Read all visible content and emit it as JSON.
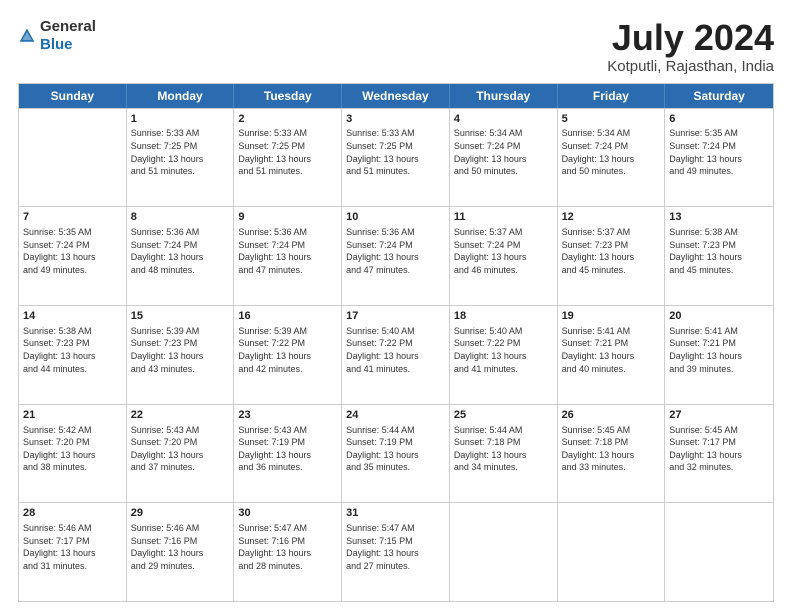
{
  "logo": {
    "text_general": "General",
    "text_blue": "Blue"
  },
  "header": {
    "month_year": "July 2024",
    "location": "Kotputli, Rajasthan, India"
  },
  "weekdays": [
    "Sunday",
    "Monday",
    "Tuesday",
    "Wednesday",
    "Thursday",
    "Friday",
    "Saturday"
  ],
  "weeks": [
    [
      {
        "day": "",
        "sunrise": "",
        "sunset": "",
        "daylight": ""
      },
      {
        "day": "1",
        "sunrise": "Sunrise: 5:33 AM",
        "sunset": "Sunset: 7:25 PM",
        "daylight": "Daylight: 13 hours and 51 minutes."
      },
      {
        "day": "2",
        "sunrise": "Sunrise: 5:33 AM",
        "sunset": "Sunset: 7:25 PM",
        "daylight": "Daylight: 13 hours and 51 minutes."
      },
      {
        "day": "3",
        "sunrise": "Sunrise: 5:33 AM",
        "sunset": "Sunset: 7:25 PM",
        "daylight": "Daylight: 13 hours and 51 minutes."
      },
      {
        "day": "4",
        "sunrise": "Sunrise: 5:34 AM",
        "sunset": "Sunset: 7:24 PM",
        "daylight": "Daylight: 13 hours and 50 minutes."
      },
      {
        "day": "5",
        "sunrise": "Sunrise: 5:34 AM",
        "sunset": "Sunset: 7:24 PM",
        "daylight": "Daylight: 13 hours and 50 minutes."
      },
      {
        "day": "6",
        "sunrise": "Sunrise: 5:35 AM",
        "sunset": "Sunset: 7:24 PM",
        "daylight": "Daylight: 13 hours and 49 minutes."
      }
    ],
    [
      {
        "day": "7",
        "sunrise": "Sunrise: 5:35 AM",
        "sunset": "Sunset: 7:24 PM",
        "daylight": "Daylight: 13 hours and 49 minutes."
      },
      {
        "day": "8",
        "sunrise": "Sunrise: 5:36 AM",
        "sunset": "Sunset: 7:24 PM",
        "daylight": "Daylight: 13 hours and 48 minutes."
      },
      {
        "day": "9",
        "sunrise": "Sunrise: 5:36 AM",
        "sunset": "Sunset: 7:24 PM",
        "daylight": "Daylight: 13 hours and 47 minutes."
      },
      {
        "day": "10",
        "sunrise": "Sunrise: 5:36 AM",
        "sunset": "Sunset: 7:24 PM",
        "daylight": "Daylight: 13 hours and 47 minutes."
      },
      {
        "day": "11",
        "sunrise": "Sunrise: 5:37 AM",
        "sunset": "Sunset: 7:24 PM",
        "daylight": "Daylight: 13 hours and 46 minutes."
      },
      {
        "day": "12",
        "sunrise": "Sunrise: 5:37 AM",
        "sunset": "Sunset: 7:23 PM",
        "daylight": "Daylight: 13 hours and 45 minutes."
      },
      {
        "day": "13",
        "sunrise": "Sunrise: 5:38 AM",
        "sunset": "Sunset: 7:23 PM",
        "daylight": "Daylight: 13 hours and 45 minutes."
      }
    ],
    [
      {
        "day": "14",
        "sunrise": "Sunrise: 5:38 AM",
        "sunset": "Sunset: 7:23 PM",
        "daylight": "Daylight: 13 hours and 44 minutes."
      },
      {
        "day": "15",
        "sunrise": "Sunrise: 5:39 AM",
        "sunset": "Sunset: 7:23 PM",
        "daylight": "Daylight: 13 hours and 43 minutes."
      },
      {
        "day": "16",
        "sunrise": "Sunrise: 5:39 AM",
        "sunset": "Sunset: 7:22 PM",
        "daylight": "Daylight: 13 hours and 42 minutes."
      },
      {
        "day": "17",
        "sunrise": "Sunrise: 5:40 AM",
        "sunset": "Sunset: 7:22 PM",
        "daylight": "Daylight: 13 hours and 41 minutes."
      },
      {
        "day": "18",
        "sunrise": "Sunrise: 5:40 AM",
        "sunset": "Sunset: 7:22 PM",
        "daylight": "Daylight: 13 hours and 41 minutes."
      },
      {
        "day": "19",
        "sunrise": "Sunrise: 5:41 AM",
        "sunset": "Sunset: 7:21 PM",
        "daylight": "Daylight: 13 hours and 40 minutes."
      },
      {
        "day": "20",
        "sunrise": "Sunrise: 5:41 AM",
        "sunset": "Sunset: 7:21 PM",
        "daylight": "Daylight: 13 hours and 39 minutes."
      }
    ],
    [
      {
        "day": "21",
        "sunrise": "Sunrise: 5:42 AM",
        "sunset": "Sunset: 7:20 PM",
        "daylight": "Daylight: 13 hours and 38 minutes."
      },
      {
        "day": "22",
        "sunrise": "Sunrise: 5:43 AM",
        "sunset": "Sunset: 7:20 PM",
        "daylight": "Daylight: 13 hours and 37 minutes."
      },
      {
        "day": "23",
        "sunrise": "Sunrise: 5:43 AM",
        "sunset": "Sunset: 7:19 PM",
        "daylight": "Daylight: 13 hours and 36 minutes."
      },
      {
        "day": "24",
        "sunrise": "Sunrise: 5:44 AM",
        "sunset": "Sunset: 7:19 PM",
        "daylight": "Daylight: 13 hours and 35 minutes."
      },
      {
        "day": "25",
        "sunrise": "Sunrise: 5:44 AM",
        "sunset": "Sunset: 7:18 PM",
        "daylight": "Daylight: 13 hours and 34 minutes."
      },
      {
        "day": "26",
        "sunrise": "Sunrise: 5:45 AM",
        "sunset": "Sunset: 7:18 PM",
        "daylight": "Daylight: 13 hours and 33 minutes."
      },
      {
        "day": "27",
        "sunrise": "Sunrise: 5:45 AM",
        "sunset": "Sunset: 7:17 PM",
        "daylight": "Daylight: 13 hours and 32 minutes."
      }
    ],
    [
      {
        "day": "28",
        "sunrise": "Sunrise: 5:46 AM",
        "sunset": "Sunset: 7:17 PM",
        "daylight": "Daylight: 13 hours and 31 minutes."
      },
      {
        "day": "29",
        "sunrise": "Sunrise: 5:46 AM",
        "sunset": "Sunset: 7:16 PM",
        "daylight": "Daylight: 13 hours and 29 minutes."
      },
      {
        "day": "30",
        "sunrise": "Sunrise: 5:47 AM",
        "sunset": "Sunset: 7:16 PM",
        "daylight": "Daylight: 13 hours and 28 minutes."
      },
      {
        "day": "31",
        "sunrise": "Sunrise: 5:47 AM",
        "sunset": "Sunset: 7:15 PM",
        "daylight": "Daylight: 13 hours and 27 minutes."
      },
      {
        "day": "",
        "sunrise": "",
        "sunset": "",
        "daylight": ""
      },
      {
        "day": "",
        "sunrise": "",
        "sunset": "",
        "daylight": ""
      },
      {
        "day": "",
        "sunrise": "",
        "sunset": "",
        "daylight": ""
      }
    ]
  ]
}
